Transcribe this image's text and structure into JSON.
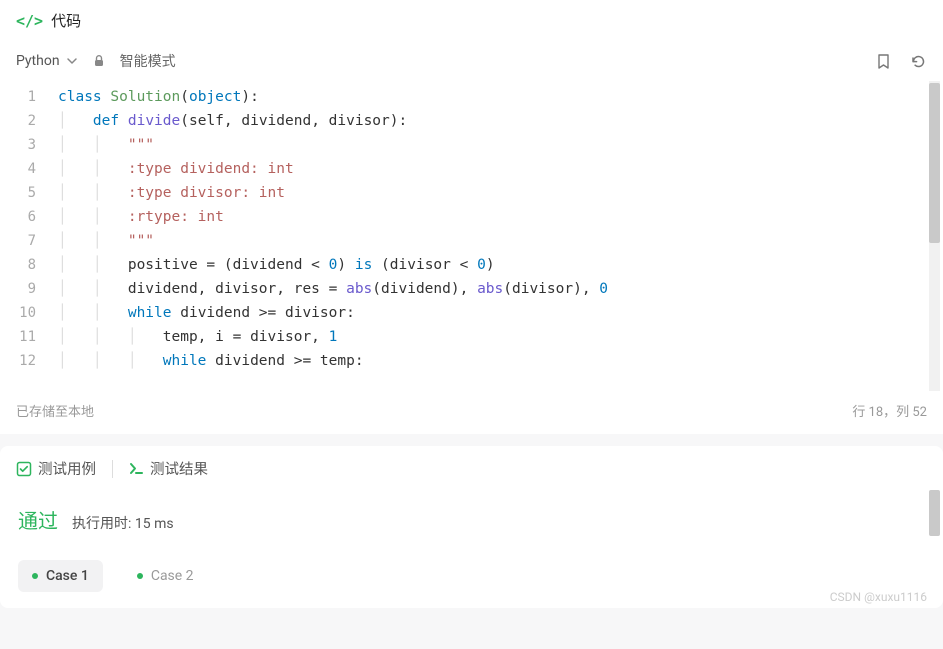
{
  "header": {
    "title": "代码"
  },
  "toolbar": {
    "language": "Python",
    "mode": "智能模式"
  },
  "editor": {
    "lines": [
      1,
      2,
      3,
      4,
      5,
      6,
      7,
      8,
      9,
      10,
      11,
      12
    ],
    "code": {
      "l1_class": "class",
      "l1_name": "Solution",
      "l1_obj": "object",
      "l2_def": "def",
      "l2_fn": "divide",
      "l2_params": "(self, dividend, divisor):",
      "l3": "\"\"\"",
      "l4": ":type dividend: int",
      "l5": ":type divisor: int",
      "l6": ":rtype: int",
      "l7": "\"\"\"",
      "l8a": "positive = (dividend < ",
      "l8z": "0",
      "l8b": ") ",
      "l8is": "is",
      "l8c": " (divisor < ",
      "l8z2": "0",
      "l8d": ")",
      "l9a": "dividend, divisor, res = ",
      "l9abs": "abs",
      "l9b": "(dividend), ",
      "l9abs2": "abs",
      "l9c": "(divisor), ",
      "l9z": "0",
      "l10_while": "while",
      "l10_rest": " dividend >= divisor:",
      "l11": "temp, i = divisor, ",
      "l11_one": "1",
      "l12_while": "while",
      "l12_rest": " dividend >= temp:"
    }
  },
  "footer": {
    "saved": "已存储至本地",
    "cursor": "行 18，列 52"
  },
  "results": {
    "tab_testcase": "测试用例",
    "tab_result": "测试结果",
    "pass": "通过",
    "runtime": "执行用时: 15 ms",
    "cases": {
      "case1": "Case 1",
      "case2": "Case 2"
    }
  },
  "watermark": "CSDN @xuxu1116"
}
